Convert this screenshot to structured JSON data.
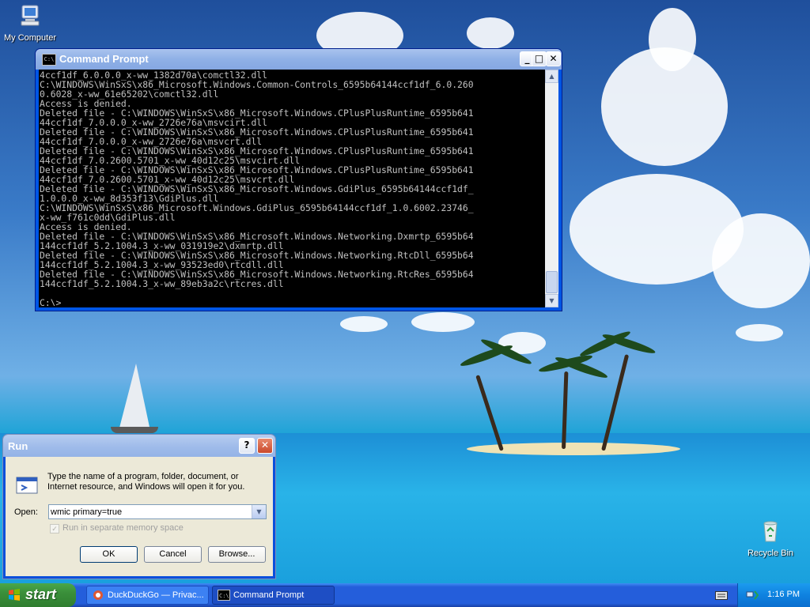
{
  "desktop": {
    "icons": [
      {
        "label": "My Computer"
      },
      {
        "label": "Recycle Bin"
      }
    ]
  },
  "cmd": {
    "title": "Command Prompt",
    "title_icon": "C:\\",
    "lines": [
      "4ccf1df_6.0.0.0_x-ww_1382d70a\\comctl32.dll",
      "C:\\WINDOWS\\WinSxS\\x86_Microsoft.Windows.Common-Controls_6595b64144ccf1df_6.0.260",
      "0.6028_x-ww_61e65202\\comctl32.dll",
      "Access is denied.",
      "Deleted file - C:\\WINDOWS\\WinSxS\\x86_Microsoft.Windows.CPlusPlusRuntime_6595b641",
      "44ccf1df_7.0.0.0_x-ww_2726e76a\\msvcirt.dll",
      "Deleted file - C:\\WINDOWS\\WinSxS\\x86_Microsoft.Windows.CPlusPlusRuntime_6595b641",
      "44ccf1df_7.0.0.0_x-ww_2726e76a\\msvcrt.dll",
      "Deleted file - C:\\WINDOWS\\WinSxS\\x86_Microsoft.Windows.CPlusPlusRuntime_6595b641",
      "44ccf1df_7.0.2600.5701_x-ww_40d12c25\\msvcirt.dll",
      "Deleted file - C:\\WINDOWS\\WinSxS\\x86_Microsoft.Windows.CPlusPlusRuntime_6595b641",
      "44ccf1df_7.0.2600.5701_x-ww_40d12c25\\msvcrt.dll",
      "Deleted file - C:\\WINDOWS\\WinSxS\\x86_Microsoft.Windows.GdiPlus_6595b64144ccf1df_",
      "1.0.0.0_x-ww_8d353f13\\GdiPlus.dll",
      "C:\\WINDOWS\\WinSxS\\x86_Microsoft.Windows.GdiPlus_6595b64144ccf1df_1.0.6002.23746_",
      "x-ww_f761c0dd\\GdiPlus.dll",
      "Access is denied.",
      "Deleted file - C:\\WINDOWS\\WinSxS\\x86_Microsoft.Windows.Networking.Dxmrtp_6595b64",
      "144ccf1df_5.2.1004.3_x-ww_031919e2\\dxmrtp.dll",
      "Deleted file - C:\\WINDOWS\\WinSxS\\x86_Microsoft.Windows.Networking.RtcDll_6595b64",
      "144ccf1df_5.2.1004.3_x-ww_93523ed0\\rtcdll.dll",
      "Deleted file - C:\\WINDOWS\\WinSxS\\x86_Microsoft.Windows.Networking.RtcRes_6595b64",
      "144ccf1df_5.2.1004.3_x-ww_89eb3a2c\\rtcres.dll",
      "",
      "C:\\>"
    ]
  },
  "run": {
    "title": "Run",
    "description": "Type the name of a program, folder, document, or Internet resource, and Windows will open it for you.",
    "open_label": "Open:",
    "open_value": "wmic primary=true",
    "checkbox_label": "Run in separate memory space",
    "ok_label": "OK",
    "cancel_label": "Cancel",
    "browse_label": "Browse..."
  },
  "taskbar": {
    "start_label": "start",
    "tasks": [
      {
        "label": "DuckDuckGo — Privac..."
      },
      {
        "label": "Command Prompt"
      }
    ],
    "clock": "1:16 PM"
  },
  "colors": {
    "taskbar_blue": "#245edb",
    "start_green": "#3a8f3a",
    "dialog_face": "#ece9d8",
    "console_bg": "#000000",
    "console_fg": "#c0c0c0"
  }
}
